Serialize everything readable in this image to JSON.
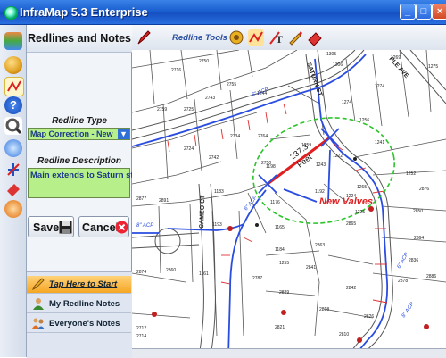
{
  "window": {
    "title": "InfraMap 5.3 Enterprise"
  },
  "panel": {
    "title": "Redlines and Notes",
    "redline_type_label": "Redline Type",
    "redline_type_value": "Map Correction - New",
    "redline_description_label": "Redline Description",
    "redline_description_value": "Main extends to Saturn st.",
    "save_label": "Save",
    "cancel_label": "Cancel",
    "nav": [
      {
        "label": "Tap Here to Start"
      },
      {
        "label": "My Redline Notes"
      },
      {
        "label": "Everyone's Notes"
      }
    ]
  },
  "toolbar": {
    "label": "Redline Tools"
  },
  "map": {
    "streets": [
      "SATURN ST",
      "CAMEO CT",
      "PLE AVE"
    ],
    "pipe_labels": [
      "6\" ACP",
      "6\" ACP",
      "8\" ACP",
      "6\" ACP",
      "8\" ACP"
    ],
    "measurement_value": "237.3",
    "measurement_unit": "Feet",
    "annotation": "New Valves",
    "parcels": [
      "2750",
      "2725",
      "2716",
      "2755",
      "2743",
      "2725",
      "2759",
      "2734",
      "2724",
      "2742",
      "2750",
      "2764",
      "1259",
      "1243",
      "1222",
      "1256",
      "1265",
      "1241",
      "1224",
      "1225",
      "1252",
      "1198",
      "1176",
      "1192",
      "1183",
      "1193",
      "1165",
      "1161",
      "2891",
      "2877",
      "2874",
      "2860",
      "1255",
      "1184",
      "2863",
      "2865",
      "2850",
      "2841",
      "2842",
      "2836",
      "2829",
      "2787",
      "2826",
      "2818",
      "2714",
      "2712",
      "2810",
      "2821",
      "2864",
      "2876",
      "2886",
      "2878",
      "1275",
      "1274",
      "1269",
      "1305",
      "1306",
      "1244",
      "1274"
    ]
  },
  "colors": {
    "titlebar": "#1b5fd0",
    "field": "#b7f08a",
    "redline": "#e02020",
    "pipe": "#2a4de0",
    "buffer": "#2bc42b"
  }
}
